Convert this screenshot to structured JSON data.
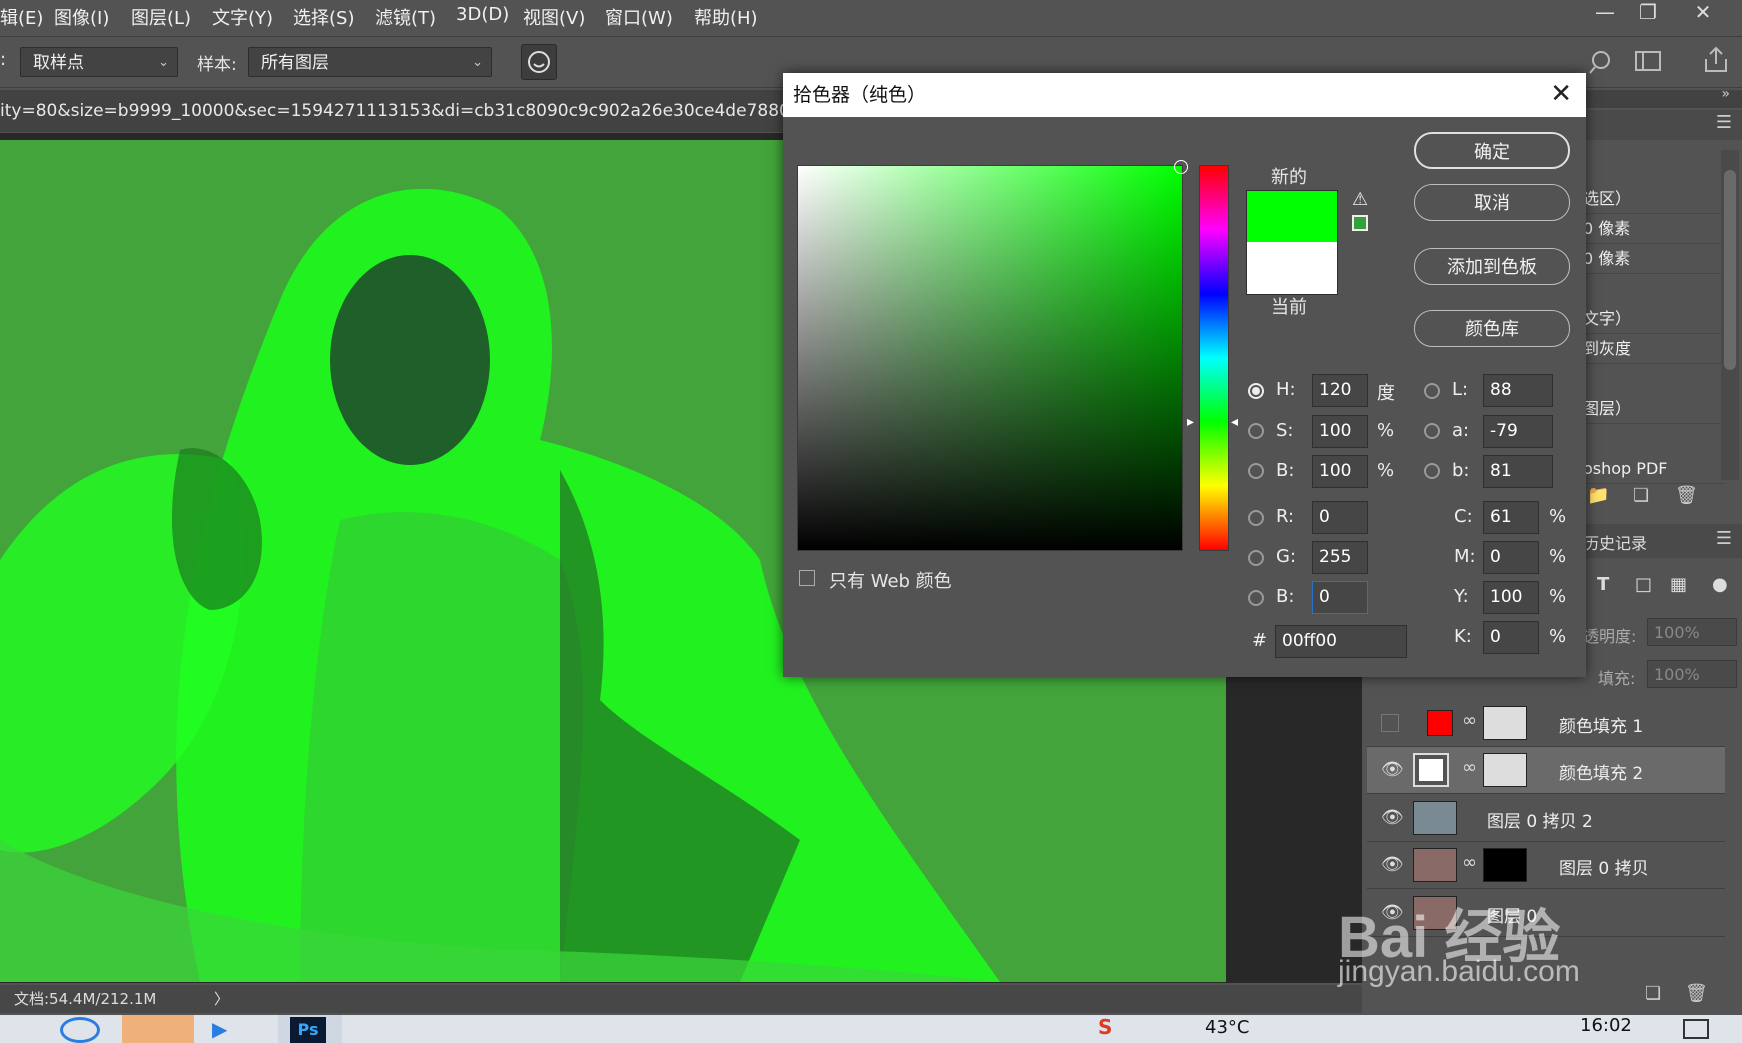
{
  "menu": {
    "items": [
      "辑(E)",
      "图像(I)",
      "图层(L)",
      "文字(Y)",
      "选择(S)",
      "滤镜(T)",
      "3D(D)",
      "视图(V)",
      "窗口(W)",
      "帮助(H)"
    ]
  },
  "options": {
    "prefix": ":",
    "sample_size": "取样点",
    "sample_label": "样本:",
    "sample_value": "所有图层"
  },
  "document": {
    "tab_title": "ity=80&size=b9999_10000&sec=1594271113153&di=cb31c8090c9c902a26e30ce4de7880bd&img",
    "status": "文档:54.4M/212.1M",
    "status_arrow": "〉"
  },
  "dialog": {
    "title": "拾色器（纯色）",
    "ok": "确定",
    "cancel": "取消",
    "add_swatch": "添加到色板",
    "color_library": "颜色库",
    "new_label": "新的",
    "current_label": "当前",
    "new_color": "#00ff00",
    "current_color": "#ffffff",
    "web_only_label": "只有 Web 颜色",
    "fields": {
      "H": {
        "label": "H:",
        "value": "120",
        "unit": "度"
      },
      "S": {
        "label": "S:",
        "value": "100",
        "unit": "%"
      },
      "Bri": {
        "label": "B:",
        "value": "100",
        "unit": "%"
      },
      "R": {
        "label": "R:",
        "value": "0"
      },
      "G": {
        "label": "G:",
        "value": "255"
      },
      "Blue": {
        "label": "B:",
        "value": "0"
      },
      "L": {
        "label": "L:",
        "value": "88"
      },
      "a": {
        "label": "a:",
        "value": "-79"
      },
      "b": {
        "label": "b:",
        "value": "81"
      },
      "C": {
        "label": "C:",
        "value": "61",
        "unit": "%"
      },
      "M": {
        "label": "M:",
        "value": "0",
        "unit": "%"
      },
      "Y": {
        "label": "Y:",
        "value": "100",
        "unit": "%"
      },
      "K": {
        "label": "K:",
        "value": "0",
        "unit": "%"
      }
    },
    "hash": "#",
    "hex": "00ff00"
  },
  "panel": {
    "rows": [
      "选区）",
      "0 像素",
      "0 像素",
      "文字）",
      "到灰度",
      "图层）",
      "oshop PDF"
    ],
    "history_tab": "历史记录",
    "opacity_label": "透明度:",
    "opacity_value": "100%",
    "fill_label": "填充:",
    "fill_value": "100%",
    "layers": [
      {
        "name": "颜色填充 1",
        "color": "#ff0000"
      },
      {
        "name": "颜色填充 2",
        "color": "#ffffff"
      },
      {
        "name": "图层 0 拷贝 2"
      },
      {
        "name": "图层 0 拷贝"
      },
      {
        "name": "图层 0"
      }
    ]
  },
  "taskbar": {
    "temperature": "43°C",
    "time": "16:02"
  },
  "watermark": {
    "brand": "Bai 经验",
    "url": "jingyan.baidu.com"
  }
}
